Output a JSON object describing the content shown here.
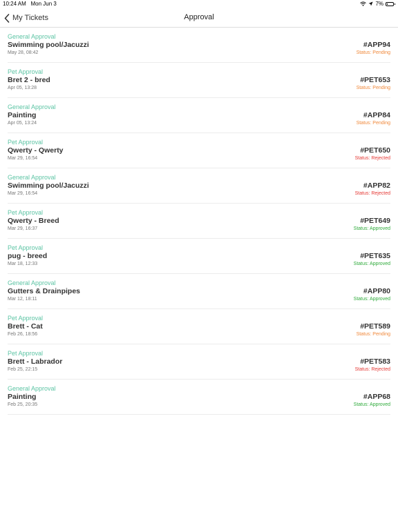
{
  "status_bar": {
    "time": "10:24 AM",
    "date": "Mon Jun 3",
    "battery": "7%",
    "battery_level": 0.07
  },
  "nav": {
    "back_label": "My Tickets",
    "title": "Approval"
  },
  "colors": {
    "category": "#5cc4a4",
    "pending": "#f0883a",
    "rejected": "#e53935",
    "approved": "#2eaa3a"
  },
  "tickets": [
    {
      "category": "General Approval",
      "title": "Swimming pool/Jacuzzi",
      "date": "May 28, 08:42",
      "id": "#APP94",
      "status": "Status: Pending",
      "state": "pending"
    },
    {
      "category": "Pet Approval",
      "title": "Bret 2 - bred",
      "date": "Apr 05, 13:28",
      "id": "#PET653",
      "status": "Status: Pending",
      "state": "pending"
    },
    {
      "category": "General Approval",
      "title": "Painting",
      "date": "Apr 05, 13:24",
      "id": "#APP84",
      "status": "Status: Pending",
      "state": "pending"
    },
    {
      "category": "Pet Approval",
      "title": "Qwerty - Qwerty",
      "date": "Mar 29, 16:54",
      "id": "#PET650",
      "status": "Status: Rejected",
      "state": "rejected"
    },
    {
      "category": "General Approval",
      "title": "Swimming pool/Jacuzzi",
      "date": "Mar 29, 16:54",
      "id": "#APP82",
      "status": "Status: Rejected",
      "state": "rejected"
    },
    {
      "category": "Pet Approval",
      "title": "Qwerty  - Breed",
      "date": "Mar 29, 16:37",
      "id": "#PET649",
      "status": "Status: Approved",
      "state": "approved"
    },
    {
      "category": "Pet Approval",
      "title": "pug - breed",
      "date": "Mar 18, 12:33",
      "id": "#PET635",
      "status": "Status: Approved",
      "state": "approved"
    },
    {
      "category": "General Approval",
      "title": "Gutters & Drainpipes",
      "date": "Mar 12, 18:11",
      "id": "#APP80",
      "status": "Status: Approved",
      "state": "approved"
    },
    {
      "category": "Pet Approval",
      "title": "Brett - Cat",
      "date": "Feb 26, 18:56",
      "id": "#PET589",
      "status": "Status: Pending",
      "state": "pending"
    },
    {
      "category": "Pet Approval",
      "title": "Brett - Labrador",
      "date": "Feb 25, 22:15",
      "id": "#PET583",
      "status": "Status: Rejected",
      "state": "rejected"
    },
    {
      "category": "General Approval",
      "title": "Painting",
      "date": "Feb 25, 20:35",
      "id": "#APP68",
      "status": "Status: Approved",
      "state": "approved"
    }
  ]
}
